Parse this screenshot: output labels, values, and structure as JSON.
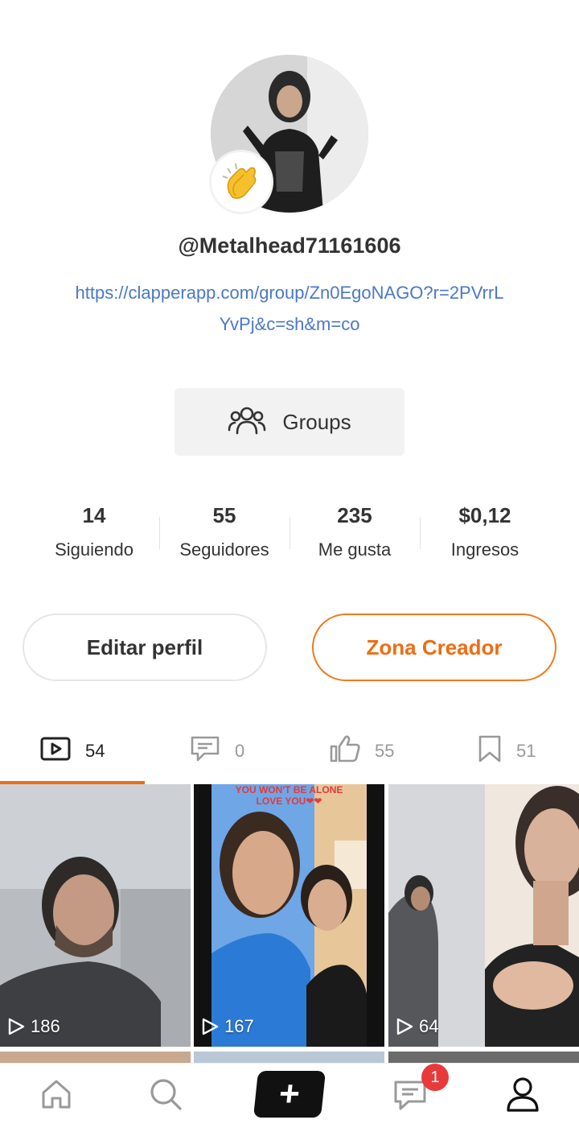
{
  "profile": {
    "username": "@Metalhead71161606",
    "link": "https://clapperapp.com/group/Zn0EgoNAGO?r=2PVrrLYvPj&c=sh&m=co",
    "badge_icon": "clapping-hands-icon"
  },
  "groups_button": {
    "label": "Groups",
    "icon": "groups-icon"
  },
  "stats": [
    {
      "value": "14",
      "label": "Siguiendo"
    },
    {
      "value": "55",
      "label": "Seguidores"
    },
    {
      "value": "235",
      "label": "Me gusta"
    },
    {
      "value": "$0,12",
      "label": "Ingresos"
    }
  ],
  "actions": {
    "edit_label": "Editar perfil",
    "creator_label": "Zona Creador"
  },
  "tabs": [
    {
      "icon": "video-icon",
      "count": "54"
    },
    {
      "icon": "comment-icon",
      "count": "0"
    },
    {
      "icon": "thumbs-up-icon",
      "count": "55"
    },
    {
      "icon": "bookmark-icon",
      "count": "51"
    }
  ],
  "videos": [
    {
      "views": "186"
    },
    {
      "views": "167",
      "overlay_text": "YOU WON'T BE ALONE\nLOVE YOU❤❤"
    },
    {
      "views": "64"
    }
  ],
  "nav": {
    "messages_badge": "1"
  },
  "colors": {
    "accent": "#ee6d12",
    "link": "#4a78c8",
    "badge": "#e83a3a"
  }
}
